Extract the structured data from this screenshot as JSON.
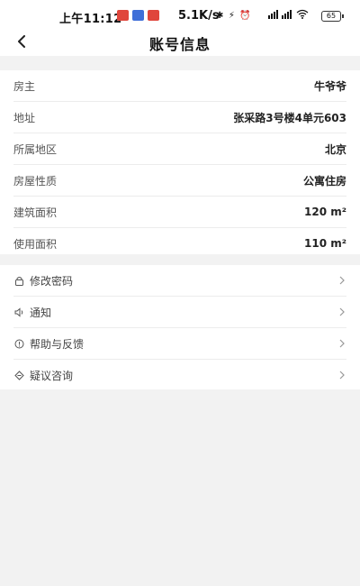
{
  "status_bar": {
    "time": "上午11:12",
    "net_speed": "5.1K/s",
    "signal_text": "∦ ∦ ▽",
    "battery": "65"
  },
  "header": {
    "title": "账号信息"
  },
  "info": [
    {
      "label": "房主",
      "value": "牛爷爷"
    },
    {
      "label": "地址",
      "value": "张采路3号楼4单元603"
    },
    {
      "label": "所属地区",
      "value": "北京"
    },
    {
      "label": "房屋性质",
      "value": "公寓住房"
    },
    {
      "label": "建筑面积",
      "value": "120 m²"
    },
    {
      "label": "使用面积",
      "value": "110 m²"
    }
  ],
  "menu": [
    {
      "label": "修改密码",
      "icon": "lock-icon"
    },
    {
      "label": "通知",
      "icon": "speaker-icon"
    },
    {
      "label": "帮助与反馈",
      "icon": "help-icon"
    },
    {
      "label": "疑议咨询",
      "icon": "inquiry-icon"
    }
  ],
  "colors": {
    "background": "#f2f2f2",
    "card": "#ffffff",
    "badge_red": "#e0463c",
    "badge_blue": "#3f6fd8"
  }
}
